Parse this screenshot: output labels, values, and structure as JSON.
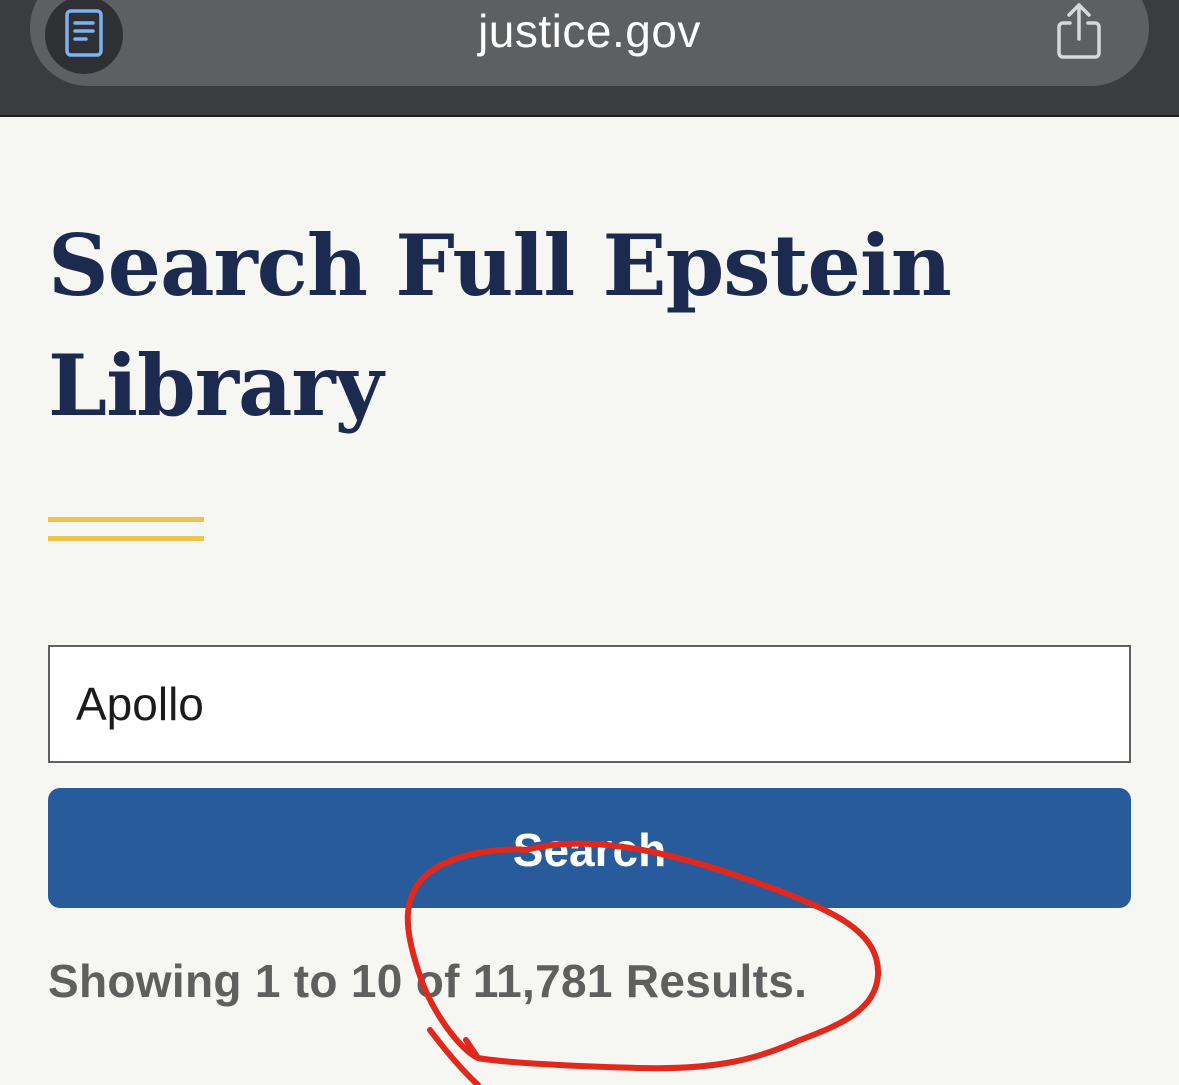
{
  "browser": {
    "url": "justice.gov",
    "reader_icon": "reader-icon",
    "share_icon": "share-icon"
  },
  "page": {
    "title": "Search Full Epstein Library",
    "search": {
      "value": "Apollo",
      "button_label": "Search"
    },
    "results_text": "Showing 1 to 10 of 11,781 Results."
  },
  "colors": {
    "title": "#1b2a4e",
    "accent_rule": "#f0c24f",
    "search_button": "#275b9b",
    "annotation_circle": "#e0291c"
  }
}
